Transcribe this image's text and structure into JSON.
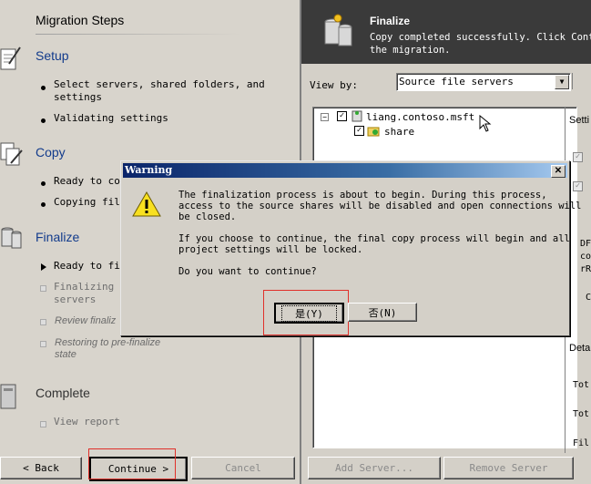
{
  "left_panel": {
    "title": "Migration Steps",
    "sections": {
      "setup": {
        "title": "Setup",
        "steps": [
          "Select servers, shared folders, and",
          "settings",
          "Validating settings"
        ]
      },
      "copy": {
        "title": "Copy",
        "steps": [
          "Ready to cop",
          "Copying file"
        ]
      },
      "finalize": {
        "title": "Finalize",
        "steps": [
          "Ready to fin",
          "Finalizing s",
          "servers",
          "Review finaliz",
          "Restoring to pre-finalize",
          "state"
        ]
      },
      "complete": {
        "title": "Complete",
        "steps": [
          "View report"
        ]
      }
    },
    "buttons": {
      "back": "< Back",
      "continue": "Continue >",
      "cancel": "Cancel"
    }
  },
  "right_panel": {
    "header": {
      "title": "Finalize",
      "description_line1": "Copy completed successfully. Click Contin",
      "description_line2": "the migration."
    },
    "view_by_label": "View by:",
    "view_by_value": "Source file servers",
    "tree": {
      "server": "liang.contoso.msft",
      "share": "share"
    },
    "side_labels": {
      "settings": "Setti",
      "df": "DF",
      "co": "co",
      "rr": "rR",
      "c": "C",
      "deta": "Deta",
      "tot1": "Tot",
      "tot2": "Tot",
      "fil": "Fil"
    },
    "buttons": {
      "add_server": "Add Server...",
      "remove_server": "Remove Server"
    }
  },
  "dialog": {
    "title": "Warning",
    "close": "✕",
    "message_line1": "The finalization process is about to begin. During this process,",
    "message_line2": "access to the source shares will be disabled and open connections will",
    "message_line3": "be closed.",
    "message_line4": "If you choose to continue, the final copy process will begin and all",
    "message_line5": "project settings will be locked.",
    "message_line6": "Do you want to continue?",
    "yes_label": "是(Y)",
    "no_label": "否(N)"
  },
  "colors": {
    "section_title": "#123b8c",
    "highlight_box": "#e0302a",
    "title_bar": "#0a246a"
  }
}
